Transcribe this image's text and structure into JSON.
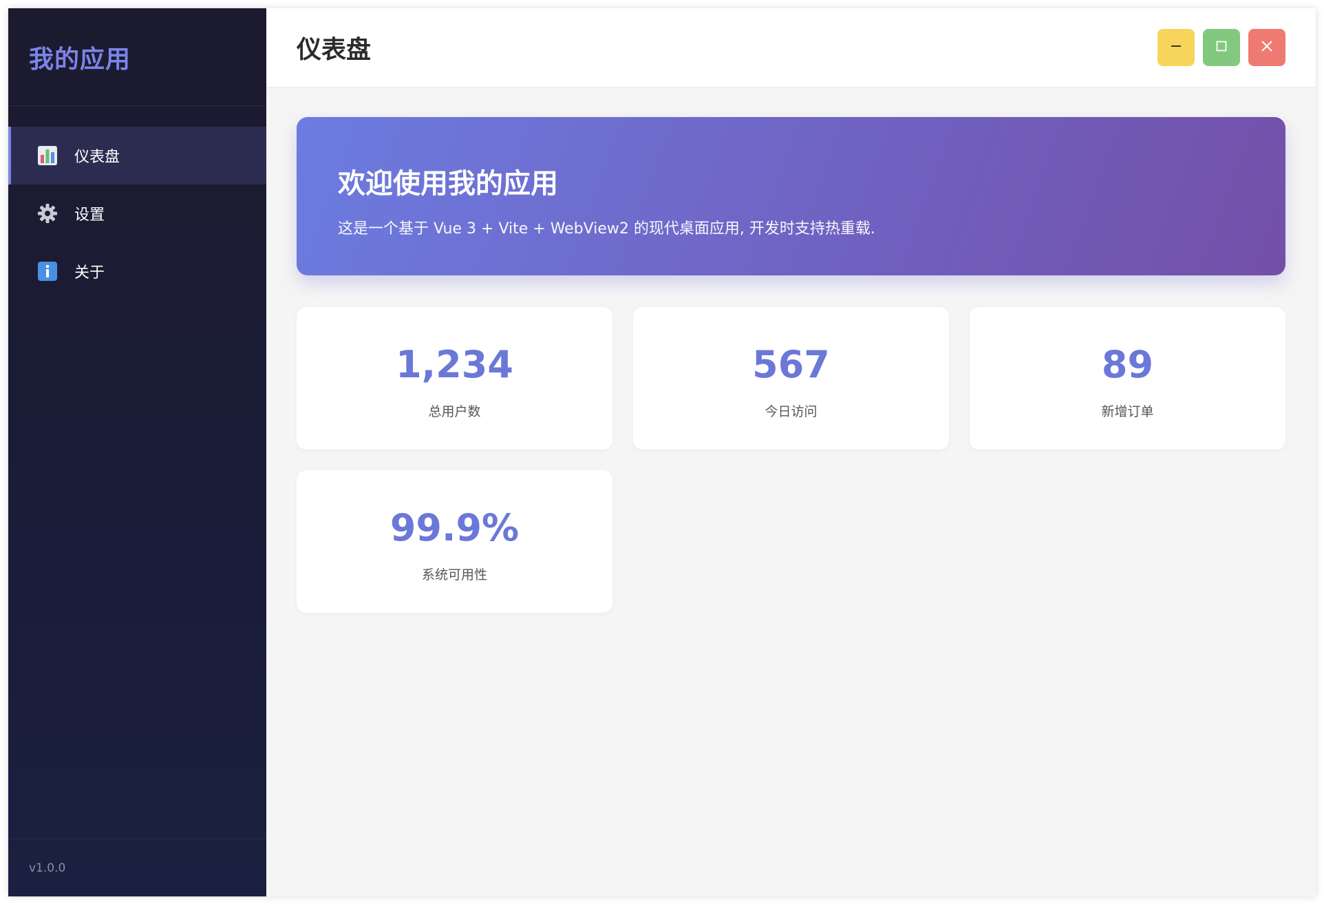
{
  "app": {
    "name": "我的应用",
    "version": "v1.0.0"
  },
  "sidebar": {
    "items": [
      {
        "label": "仪表盘",
        "icon": "bar-chart-icon",
        "active": true
      },
      {
        "label": "设置",
        "icon": "gear-icon",
        "active": false
      },
      {
        "label": "关于",
        "icon": "info-icon",
        "active": false
      }
    ]
  },
  "header": {
    "title": "仪表盘",
    "controls": {
      "minimize": "minimize-icon",
      "maximize": "maximize-icon",
      "close": "close-icon"
    }
  },
  "banner": {
    "title": "欢迎使用我的应用",
    "subtitle": "这是一个基于 Vue 3 + Vite + WebView2 的现代桌面应用, 开发时支持热重载."
  },
  "stats": [
    {
      "value": "1,234",
      "label": "总用户数"
    },
    {
      "value": "567",
      "label": "今日访问"
    },
    {
      "value": "89",
      "label": "新增订单"
    },
    {
      "value": "99.9%",
      "label": "系统可用性"
    }
  ],
  "colors": {
    "accent": "#6b78d8",
    "sidebar_bg": "#1a1c38",
    "minimize": "#f7d55a",
    "maximize": "#82c97f",
    "close": "#ee7a72"
  }
}
